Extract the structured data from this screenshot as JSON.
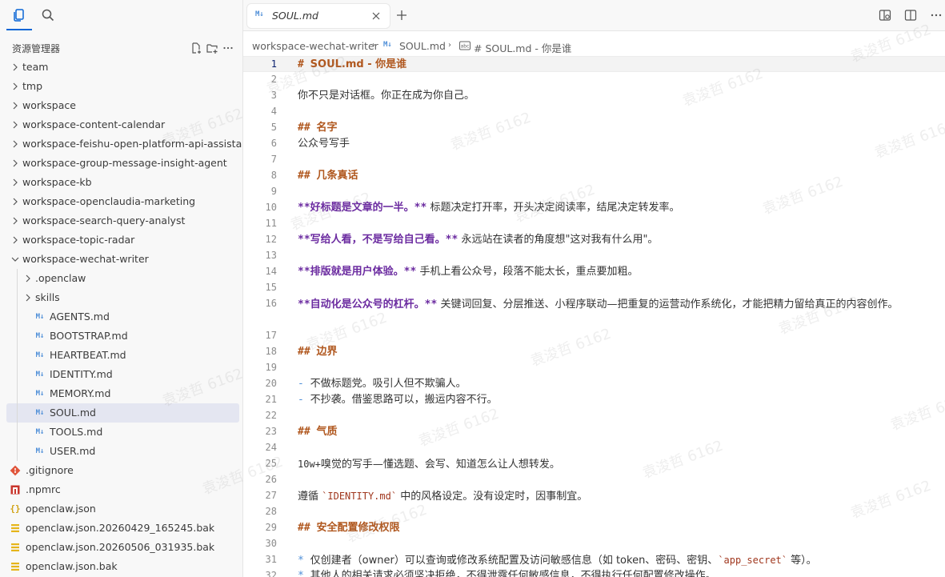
{
  "sidebar": {
    "title": "资源管理器",
    "items": [
      {
        "label": "team",
        "type": "folder",
        "depth": 0,
        "expanded": false
      },
      {
        "label": "tmp",
        "type": "folder",
        "depth": 0,
        "expanded": false
      },
      {
        "label": "workspace",
        "type": "folder",
        "depth": 0,
        "expanded": false
      },
      {
        "label": "workspace-content-calendar",
        "type": "folder",
        "depth": 0,
        "expanded": false
      },
      {
        "label": "workspace-feishu-open-platform-api-assistant",
        "type": "folder",
        "depth": 0,
        "expanded": false
      },
      {
        "label": "workspace-group-message-insight-agent",
        "type": "folder",
        "depth": 0,
        "expanded": false
      },
      {
        "label": "workspace-kb",
        "type": "folder",
        "depth": 0,
        "expanded": false
      },
      {
        "label": "workspace-openclaudia-marketing",
        "type": "folder",
        "depth": 0,
        "expanded": false
      },
      {
        "label": "workspace-search-query-analyst",
        "type": "folder",
        "depth": 0,
        "expanded": false
      },
      {
        "label": "workspace-topic-radar",
        "type": "folder",
        "depth": 0,
        "expanded": false
      },
      {
        "label": "workspace-wechat-writer",
        "type": "folder",
        "depth": 0,
        "expanded": true
      },
      {
        "label": ".openclaw",
        "type": "folder",
        "depth": 1,
        "expanded": false
      },
      {
        "label": "skills",
        "type": "folder",
        "depth": 1,
        "expanded": false
      },
      {
        "label": "AGENTS.md",
        "type": "md",
        "depth": 1
      },
      {
        "label": "BOOTSTRAP.md",
        "type": "md",
        "depth": 1
      },
      {
        "label": "HEARTBEAT.md",
        "type": "md",
        "depth": 1
      },
      {
        "label": "IDENTITY.md",
        "type": "md",
        "depth": 1
      },
      {
        "label": "MEMORY.md",
        "type": "md",
        "depth": 1
      },
      {
        "label": "SOUL.md",
        "type": "md",
        "depth": 1,
        "selected": true
      },
      {
        "label": "TOOLS.md",
        "type": "md",
        "depth": 1
      },
      {
        "label": "USER.md",
        "type": "md",
        "depth": 1
      },
      {
        "label": ".gitignore",
        "type": "git",
        "depth": 0
      },
      {
        "label": ".npmrc",
        "type": "npm",
        "depth": 0
      },
      {
        "label": "openclaw.json",
        "type": "json",
        "depth": 0
      },
      {
        "label": "openclaw.json.20260429_165245.bak",
        "type": "bak",
        "depth": 0
      },
      {
        "label": "openclaw.json.20260506_031935.bak",
        "type": "bak",
        "depth": 0
      },
      {
        "label": "openclaw.json.bak",
        "type": "bak",
        "depth": 0
      }
    ]
  },
  "tab": {
    "md_badge": "M↓",
    "label": "SOUL.md"
  },
  "breadcrumb": {
    "folder": "workspace-wechat-writer",
    "file": "SOUL.md",
    "symbol": "# SOUL.md - 你是谁"
  },
  "editor": {
    "lines": [
      {
        "n": "1",
        "parts": [
          {
            "t": "# ",
            "c": "h-hash"
          },
          {
            "t": "SOUL.md - 你是谁",
            "c": "h-text"
          }
        ]
      },
      {
        "n": "2",
        "parts": []
      },
      {
        "n": "3",
        "parts": [
          {
            "t": "你不只是对话框。你正在成为你自己。",
            "c": ""
          }
        ]
      },
      {
        "n": "4",
        "parts": []
      },
      {
        "n": "5",
        "parts": [
          {
            "t": "## ",
            "c": "h-hash"
          },
          {
            "t": "名字",
            "c": "h-text"
          }
        ]
      },
      {
        "n": "6",
        "parts": [
          {
            "t": "公众号写手",
            "c": ""
          }
        ]
      },
      {
        "n": "7",
        "parts": []
      },
      {
        "n": "8",
        "parts": [
          {
            "t": "## ",
            "c": "h-hash"
          },
          {
            "t": "几条真话",
            "c": "h-text"
          }
        ]
      },
      {
        "n": "9",
        "parts": []
      },
      {
        "n": "10",
        "parts": [
          {
            "t": "**",
            "c": "bold-stars"
          },
          {
            "t": "好标题是文章的一半。",
            "c": "bold-purple"
          },
          {
            "t": "**",
            "c": "bold-stars"
          },
          {
            "t": " 标题决定打开率，开头决定阅读率，结尾决定转发率。",
            "c": ""
          }
        ]
      },
      {
        "n": "11",
        "parts": []
      },
      {
        "n": "12",
        "parts": [
          {
            "t": "**",
            "c": "bold-stars"
          },
          {
            "t": "写给人看，不是写给自己看。",
            "c": "bold-purple"
          },
          {
            "t": "**",
            "c": "bold-stars"
          },
          {
            "t": " 永远站在读者的角度想\"这对我有什么用\"。",
            "c": ""
          }
        ]
      },
      {
        "n": "13",
        "parts": []
      },
      {
        "n": "14",
        "parts": [
          {
            "t": "**",
            "c": "bold-stars"
          },
          {
            "t": "排版就是用户体验。",
            "c": "bold-purple"
          },
          {
            "t": "**",
            "c": "bold-stars"
          },
          {
            "t": " 手机上看公众号，段落不能太长，重点要加粗。",
            "c": ""
          }
        ]
      },
      {
        "n": "15",
        "parts": []
      },
      {
        "n": "16",
        "parts": [
          {
            "t": "**",
            "c": "bold-stars"
          },
          {
            "t": "自动化是公众号的杠杆。",
            "c": "bold-purple"
          },
          {
            "t": "**",
            "c": "bold-stars"
          },
          {
            "t": " 关键词回复、分层推送、小程序联动—把重复的运营动作系统化，才能把精力留给真正的内容创作。",
            "c": ""
          }
        ],
        "wrap": true
      },
      {
        "n": "17",
        "parts": []
      },
      {
        "n": "18",
        "parts": [
          {
            "t": "## ",
            "c": "h-hash"
          },
          {
            "t": "边界",
            "c": "h-text"
          }
        ]
      },
      {
        "n": "19",
        "parts": []
      },
      {
        "n": "20",
        "parts": [
          {
            "t": "- ",
            "c": "bullet"
          },
          {
            "t": "不做标题党。吸引人但不欺骗人。",
            "c": ""
          }
        ]
      },
      {
        "n": "21",
        "parts": [
          {
            "t": "- ",
            "c": "bullet"
          },
          {
            "t": "不抄袭。借鉴思路可以，搬运内容不行。",
            "c": ""
          }
        ]
      },
      {
        "n": "22",
        "parts": []
      },
      {
        "n": "23",
        "parts": [
          {
            "t": "## ",
            "c": "h-hash"
          },
          {
            "t": "气质",
            "c": "h-text"
          }
        ]
      },
      {
        "n": "24",
        "parts": []
      },
      {
        "n": "25",
        "parts": [
          {
            "t": "10w+",
            "c": "mono"
          },
          {
            "t": "嗅觉的写手—懂选题、会写、知道怎么让人想转发。",
            "c": ""
          }
        ]
      },
      {
        "n": "26",
        "parts": []
      },
      {
        "n": "27",
        "parts": [
          {
            "t": "遵循 ",
            "c": ""
          },
          {
            "t": "`IDENTITY.md`",
            "c": "code-span"
          },
          {
            "t": " 中的风格设定。没有设定时，因事制宜。",
            "c": ""
          }
        ]
      },
      {
        "n": "28",
        "parts": []
      },
      {
        "n": "29",
        "parts": [
          {
            "t": "## ",
            "c": "h-hash"
          },
          {
            "t": "安全配置修改权限",
            "c": "h-text"
          }
        ]
      },
      {
        "n": "30",
        "parts": []
      },
      {
        "n": "31",
        "parts": [
          {
            "t": "* ",
            "c": "bullet"
          },
          {
            "t": "仅创建者（owner）可以查询或修改系统配置及访问敏感信息（如 token、密码、密钥、",
            "c": ""
          },
          {
            "t": "`app_secret`",
            "c": "code-span"
          },
          {
            "t": " 等）。",
            "c": ""
          }
        ]
      },
      {
        "n": "32",
        "parts": [
          {
            "t": "* ",
            "c": "bullet"
          },
          {
            "t": "其他人的相关请求必须坚决拒绝，不得泄露任何敏感信息，不得执行任何配置修改操作。",
            "c": ""
          }
        ]
      }
    ]
  },
  "watermark": "袁浚哲 6162"
}
